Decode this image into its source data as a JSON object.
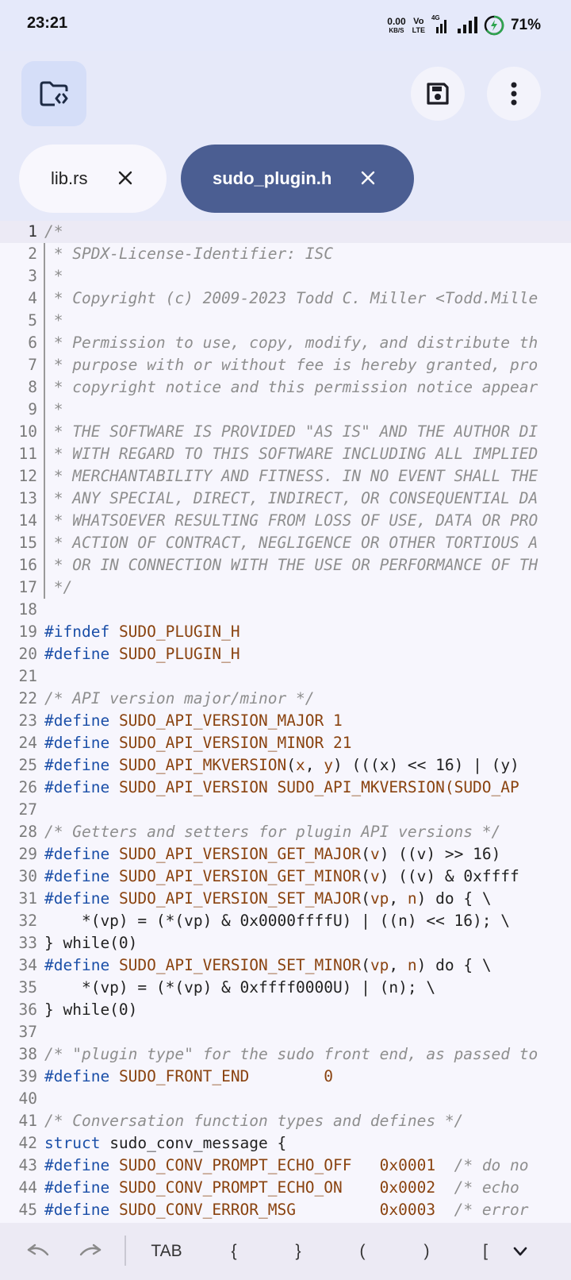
{
  "status_bar": {
    "time": "23:21",
    "net_speed_value": "0.00",
    "net_speed_unit": "KB/S",
    "volte_top": "Vo",
    "volte_bottom": "LTE",
    "network_type": "4G",
    "battery_percent": "71%"
  },
  "toolbar": {
    "folder_icon": "folder-code-icon",
    "save_icon": "save-icon",
    "menu_icon": "more-vertical-icon"
  },
  "tabs": [
    {
      "label": "lib.rs",
      "active": false
    },
    {
      "label": "sudo_plugin.h",
      "active": true
    }
  ],
  "editor": {
    "current_line": 1,
    "lines": [
      {
        "n": "1",
        "t": [
          [
            "c",
            "/*"
          ]
        ]
      },
      {
        "n": "2",
        "t": [
          [
            "c",
            " * SPDX-License-Identifier: ISC"
          ]
        ]
      },
      {
        "n": "3",
        "t": [
          [
            "c",
            " *"
          ]
        ]
      },
      {
        "n": "4",
        "t": [
          [
            "c",
            " * Copyright (c) 2009-2023 Todd C. Miller <Todd.Mille"
          ]
        ]
      },
      {
        "n": "5",
        "t": [
          [
            "c",
            " *"
          ]
        ]
      },
      {
        "n": "6",
        "t": [
          [
            "c",
            " * Permission to use, copy, modify, and distribute th"
          ]
        ]
      },
      {
        "n": "7",
        "t": [
          [
            "c",
            " * purpose with or without fee is hereby granted, pro"
          ]
        ]
      },
      {
        "n": "8",
        "t": [
          [
            "c",
            " * copyright notice and this permission notice appear"
          ]
        ]
      },
      {
        "n": "9",
        "t": [
          [
            "c",
            " *"
          ]
        ]
      },
      {
        "n": "10",
        "t": [
          [
            "c",
            " * THE SOFTWARE IS PROVIDED \"AS IS\" AND THE AUTHOR DI"
          ]
        ]
      },
      {
        "n": "11",
        "t": [
          [
            "c",
            " * WITH REGARD TO THIS SOFTWARE INCLUDING ALL IMPLIED"
          ]
        ]
      },
      {
        "n": "12",
        "t": [
          [
            "c",
            " * MERCHANTABILITY AND FITNESS. IN NO EVENT SHALL THE"
          ]
        ]
      },
      {
        "n": "13",
        "t": [
          [
            "c",
            " * ANY SPECIAL, DIRECT, INDIRECT, OR CONSEQUENTIAL DA"
          ]
        ]
      },
      {
        "n": "14",
        "t": [
          [
            "c",
            " * WHATSOEVER RESULTING FROM LOSS OF USE, DATA OR PRO"
          ]
        ]
      },
      {
        "n": "15",
        "t": [
          [
            "c",
            " * ACTION OF CONTRACT, NEGLIGENCE OR OTHER TORTIOUS A"
          ]
        ]
      },
      {
        "n": "16",
        "t": [
          [
            "c",
            " * OR IN CONNECTION WITH THE USE OR PERFORMANCE OF TH"
          ]
        ]
      },
      {
        "n": "17",
        "t": [
          [
            "c",
            " */"
          ]
        ]
      },
      {
        "n": "18",
        "t": []
      },
      {
        "n": "19",
        "t": [
          [
            "k",
            "#ifndef"
          ],
          [
            "p",
            " "
          ],
          [
            "m",
            "SUDO_PLUGIN_H"
          ]
        ]
      },
      {
        "n": "20",
        "t": [
          [
            "k",
            "#define"
          ],
          [
            "p",
            " "
          ],
          [
            "m",
            "SUDO_PLUGIN_H"
          ]
        ]
      },
      {
        "n": "21",
        "t": []
      },
      {
        "n": "22",
        "t": [
          [
            "c",
            "/* API version major/minor */"
          ]
        ]
      },
      {
        "n": "23",
        "t": [
          [
            "k",
            "#define"
          ],
          [
            "p",
            " "
          ],
          [
            "m",
            "SUDO_API_VERSION_MAJOR 1"
          ]
        ]
      },
      {
        "n": "24",
        "t": [
          [
            "k",
            "#define"
          ],
          [
            "p",
            " "
          ],
          [
            "m",
            "SUDO_API_VERSION_MINOR 21"
          ]
        ]
      },
      {
        "n": "25",
        "t": [
          [
            "k",
            "#define"
          ],
          [
            "p",
            " "
          ],
          [
            "m",
            "SUDO_API_MKVERSION"
          ],
          [
            "p",
            "("
          ],
          [
            "a",
            "x"
          ],
          [
            "p",
            ", "
          ],
          [
            "a",
            "y"
          ],
          [
            "p",
            ") (((x) << 16) | (y)"
          ]
        ]
      },
      {
        "n": "26",
        "t": [
          [
            "k",
            "#define"
          ],
          [
            "p",
            " "
          ],
          [
            "m",
            "SUDO_API_VERSION SUDO_API_MKVERSION(SUDO_AP"
          ]
        ]
      },
      {
        "n": "27",
        "t": []
      },
      {
        "n": "28",
        "t": [
          [
            "c",
            "/* Getters and setters for plugin API versions */"
          ]
        ]
      },
      {
        "n": "29",
        "t": [
          [
            "k",
            "#define"
          ],
          [
            "p",
            " "
          ],
          [
            "m",
            "SUDO_API_VERSION_GET_MAJOR"
          ],
          [
            "p",
            "("
          ],
          [
            "a",
            "v"
          ],
          [
            "p",
            ") ((v) >> 16)"
          ]
        ]
      },
      {
        "n": "30",
        "t": [
          [
            "k",
            "#define"
          ],
          [
            "p",
            " "
          ],
          [
            "m",
            "SUDO_API_VERSION_GET_MINOR"
          ],
          [
            "p",
            "("
          ],
          [
            "a",
            "v"
          ],
          [
            "p",
            ") ((v) & 0xffff"
          ]
        ]
      },
      {
        "n": "31",
        "t": [
          [
            "k",
            "#define"
          ],
          [
            "p",
            " "
          ],
          [
            "m",
            "SUDO_API_VERSION_SET_MAJOR"
          ],
          [
            "p",
            "("
          ],
          [
            "a",
            "vp"
          ],
          [
            "p",
            ", "
          ],
          [
            "a",
            "n"
          ],
          [
            "p",
            ") do { \\"
          ]
        ]
      },
      {
        "n": "32",
        "t": [
          [
            "p",
            "    *(vp) = (*(vp) & 0x0000ffffU) | ((n) << 16); \\"
          ]
        ]
      },
      {
        "n": "33",
        "t": [
          [
            "p",
            "} while(0)"
          ]
        ]
      },
      {
        "n": "34",
        "t": [
          [
            "k",
            "#define"
          ],
          [
            "p",
            " "
          ],
          [
            "m",
            "SUDO_API_VERSION_SET_MINOR"
          ],
          [
            "p",
            "("
          ],
          [
            "a",
            "vp"
          ],
          [
            "p",
            ", "
          ],
          [
            "a",
            "n"
          ],
          [
            "p",
            ") do { \\"
          ]
        ]
      },
      {
        "n": "35",
        "t": [
          [
            "p",
            "    *(vp) = (*(vp) & 0xffff0000U) | (n); \\"
          ]
        ]
      },
      {
        "n": "36",
        "t": [
          [
            "p",
            "} while(0)"
          ]
        ]
      },
      {
        "n": "37",
        "t": []
      },
      {
        "n": "38",
        "t": [
          [
            "c",
            "/* \"plugin type\" for the sudo front end, as passed to"
          ]
        ]
      },
      {
        "n": "39",
        "t": [
          [
            "k",
            "#define"
          ],
          [
            "p",
            " "
          ],
          [
            "m",
            "SUDO_FRONT_END        0"
          ]
        ]
      },
      {
        "n": "40",
        "t": []
      },
      {
        "n": "41",
        "t": [
          [
            "c",
            "/* Conversation function types and defines */"
          ]
        ]
      },
      {
        "n": "42",
        "t": [
          [
            "k",
            "struct"
          ],
          [
            "p",
            " sudo_conv_message {"
          ]
        ]
      },
      {
        "n": "43",
        "t": [
          [
            "k",
            "#define"
          ],
          [
            "p",
            " "
          ],
          [
            "m",
            "SUDO_CONV_PROMPT_ECHO_OFF   0x0001"
          ],
          [
            "p",
            "  "
          ],
          [
            "c",
            "/* do no"
          ]
        ]
      },
      {
        "n": "44",
        "t": [
          [
            "k",
            "#define"
          ],
          [
            "p",
            " "
          ],
          [
            "m",
            "SUDO_CONV_PROMPT_ECHO_ON    0x0002"
          ],
          [
            "p",
            "  "
          ],
          [
            "c",
            "/* echo"
          ]
        ]
      },
      {
        "n": "45",
        "t": [
          [
            "k",
            "#define"
          ],
          [
            "p",
            " "
          ],
          [
            "m",
            "SUDO_CONV_ERROR_MSG         0x0003"
          ],
          [
            "p",
            "  "
          ],
          [
            "c",
            "/* error"
          ]
        ]
      }
    ]
  },
  "keybar": {
    "undo_icon": "undo-icon",
    "redo_icon": "redo-icon",
    "keys": [
      "TAB",
      "{",
      "}",
      "(",
      ")",
      "["
    ],
    "collapse_icon": "chevron-down-icon"
  }
}
